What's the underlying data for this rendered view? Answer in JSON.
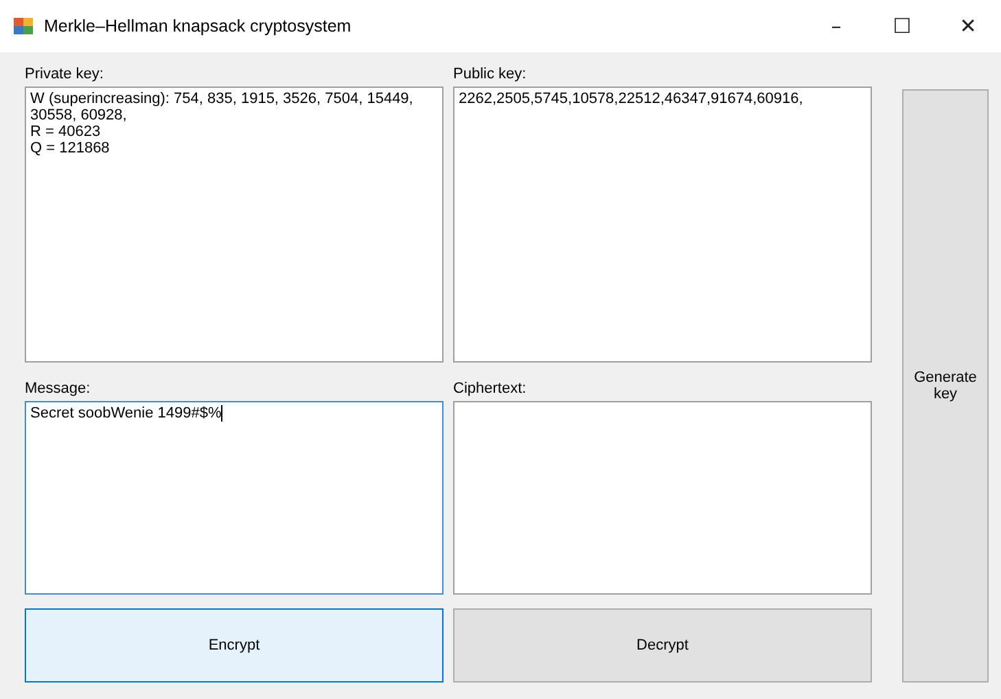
{
  "window": {
    "title": "Merkle–Hellman knapsack cryptosystem",
    "controls": [
      "–",
      "☐",
      "✕"
    ]
  },
  "fields": [
    {
      "label": "Private key:",
      "value": "W (superincreasing): 754, 835, 1915, 3526, 7504, 15449, 30558, 60928,\nR = 40623\nQ = 121868",
      "focused": false
    },
    {
      "label": "Public key:",
      "value": "2262,2505,5745,10578,22512,46347,91674,60916,",
      "focused": false
    },
    {
      "label": "Message:",
      "value": "Secret soobWenie 1499#$%",
      "focused": true
    },
    {
      "label": "Ciphertext:",
      "focused": false
    }
  ],
  "buttons": [
    {
      "label": "Encrypt",
      "highlighted": true
    },
    {
      "label": "Decrypt",
      "highlighted": false
    }
  ],
  "side_button": {
    "label": "Generate key",
    "highlighted": false
  }
}
